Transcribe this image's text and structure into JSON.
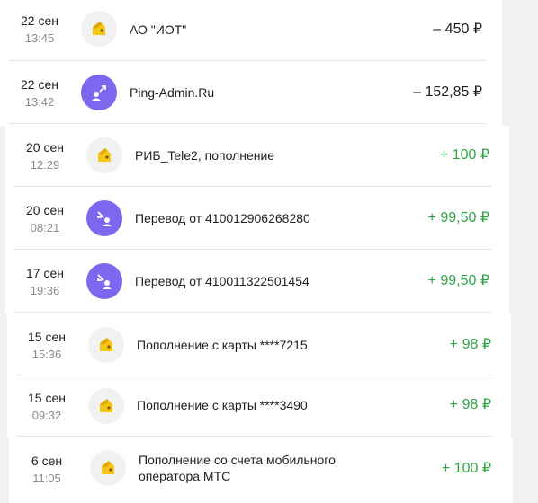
{
  "operations": [
    {
      "day": "22 сен",
      "time": "13:45",
      "title": "АО \"ИОТ\"",
      "amount": "– 450 ₽",
      "icon": "wallet-icon",
      "sign": "negative"
    },
    {
      "day": "22 сен",
      "time": "13:42",
      "title": "Ping-Admin.Ru",
      "amount": "– 152,85 ₽",
      "icon": "outgoing-transfer-icon",
      "sign": "negative"
    },
    {
      "day": "20 сен",
      "time": "12:29",
      "title": "РИБ_Tele2, пополнение",
      "amount": "+ 100 ₽",
      "icon": "wallet-icon",
      "sign": "positive"
    },
    {
      "day": "20 сен",
      "time": "08:21",
      "title": "Перевод от 410012906268280",
      "amount": "+ 99,50 ₽",
      "icon": "incoming-transfer-icon",
      "sign": "positive"
    },
    {
      "day": "17 сен",
      "time": "19:36",
      "title": "Перевод от 410011322501454",
      "amount": "+ 99,50 ₽",
      "icon": "incoming-transfer-icon",
      "sign": "positive"
    },
    {
      "day": "15 сен",
      "time": "15:36",
      "title": "Пополнение с карты ****7215",
      "amount": "+ 98 ₽",
      "icon": "wallet-icon",
      "sign": "positive"
    },
    {
      "day": "15 сен",
      "time": "09:32",
      "title": "Пополнение с карты ****3490",
      "amount": "+ 98 ₽",
      "icon": "wallet-icon",
      "sign": "positive"
    },
    {
      "day": "6 сен",
      "time": "11:05",
      "title": "Пополнение со счета мобильного оператора МТС",
      "amount": "+ 100 ₽",
      "icon": "wallet-icon",
      "sign": "positive"
    }
  ],
  "colors": {
    "positive": "#2ea447",
    "negative": "#1f1f1f",
    "transfer_icon_bg": "#7b68ee",
    "wallet_yellow": "#f5c518"
  }
}
